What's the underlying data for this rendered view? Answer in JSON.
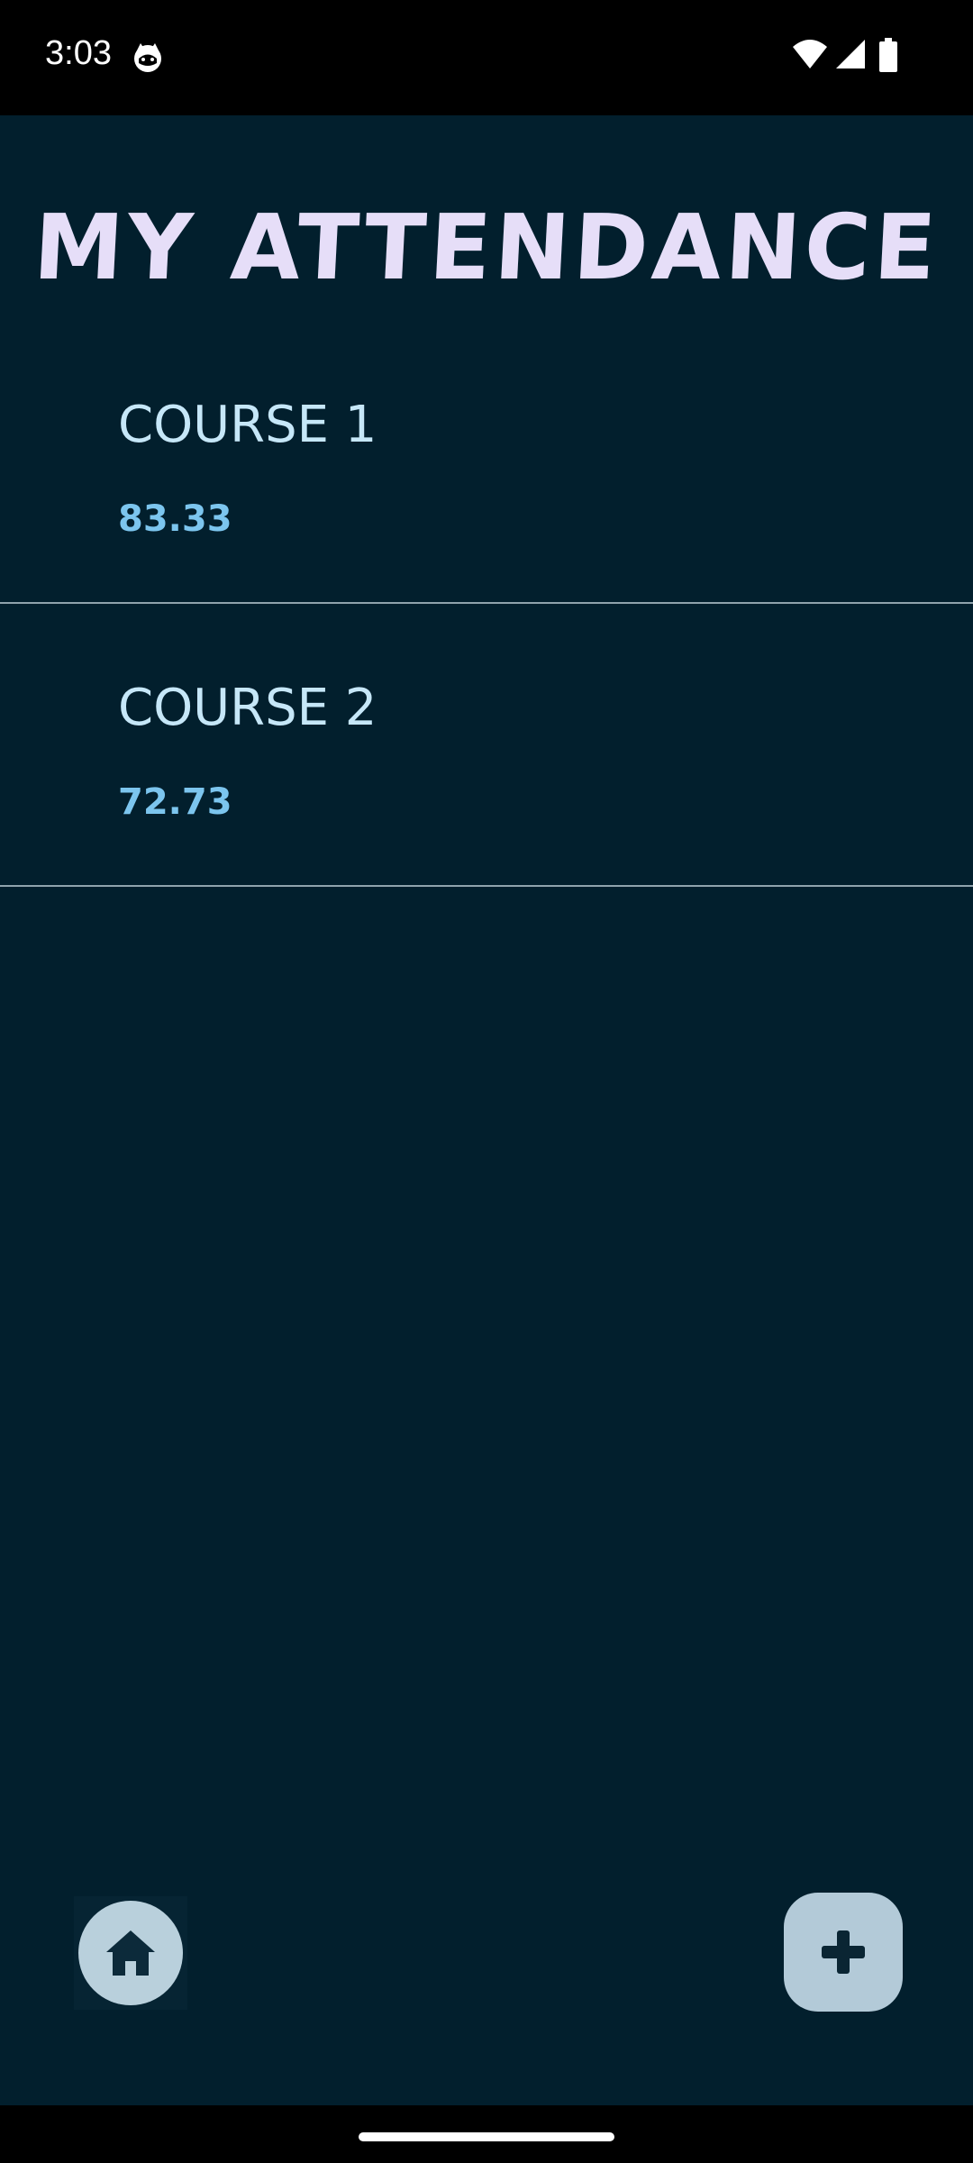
{
  "status_bar": {
    "time": "3:03",
    "app_icon": "cat-face-icon",
    "right_icons": [
      "wifi-icon",
      "cellular-signal-icon",
      "battery-icon"
    ]
  },
  "header": {
    "title": "MY ATTENDANCE"
  },
  "courses": [
    {
      "name": "COURSE 1",
      "percentage": "83.33"
    },
    {
      "name": "COURSE 2",
      "percentage": "72.73"
    }
  ],
  "bottom_actions": {
    "home_icon": "home-icon",
    "add_icon": "plus-icon"
  },
  "colors": {
    "background": "#021f2d",
    "title": "#e6def8",
    "course_name": "#c6e7f8",
    "course_percentage": "#7cc5ee",
    "divider": "#8fa3ad",
    "fab": "#b3cad8",
    "home": "#b9d0dc"
  }
}
